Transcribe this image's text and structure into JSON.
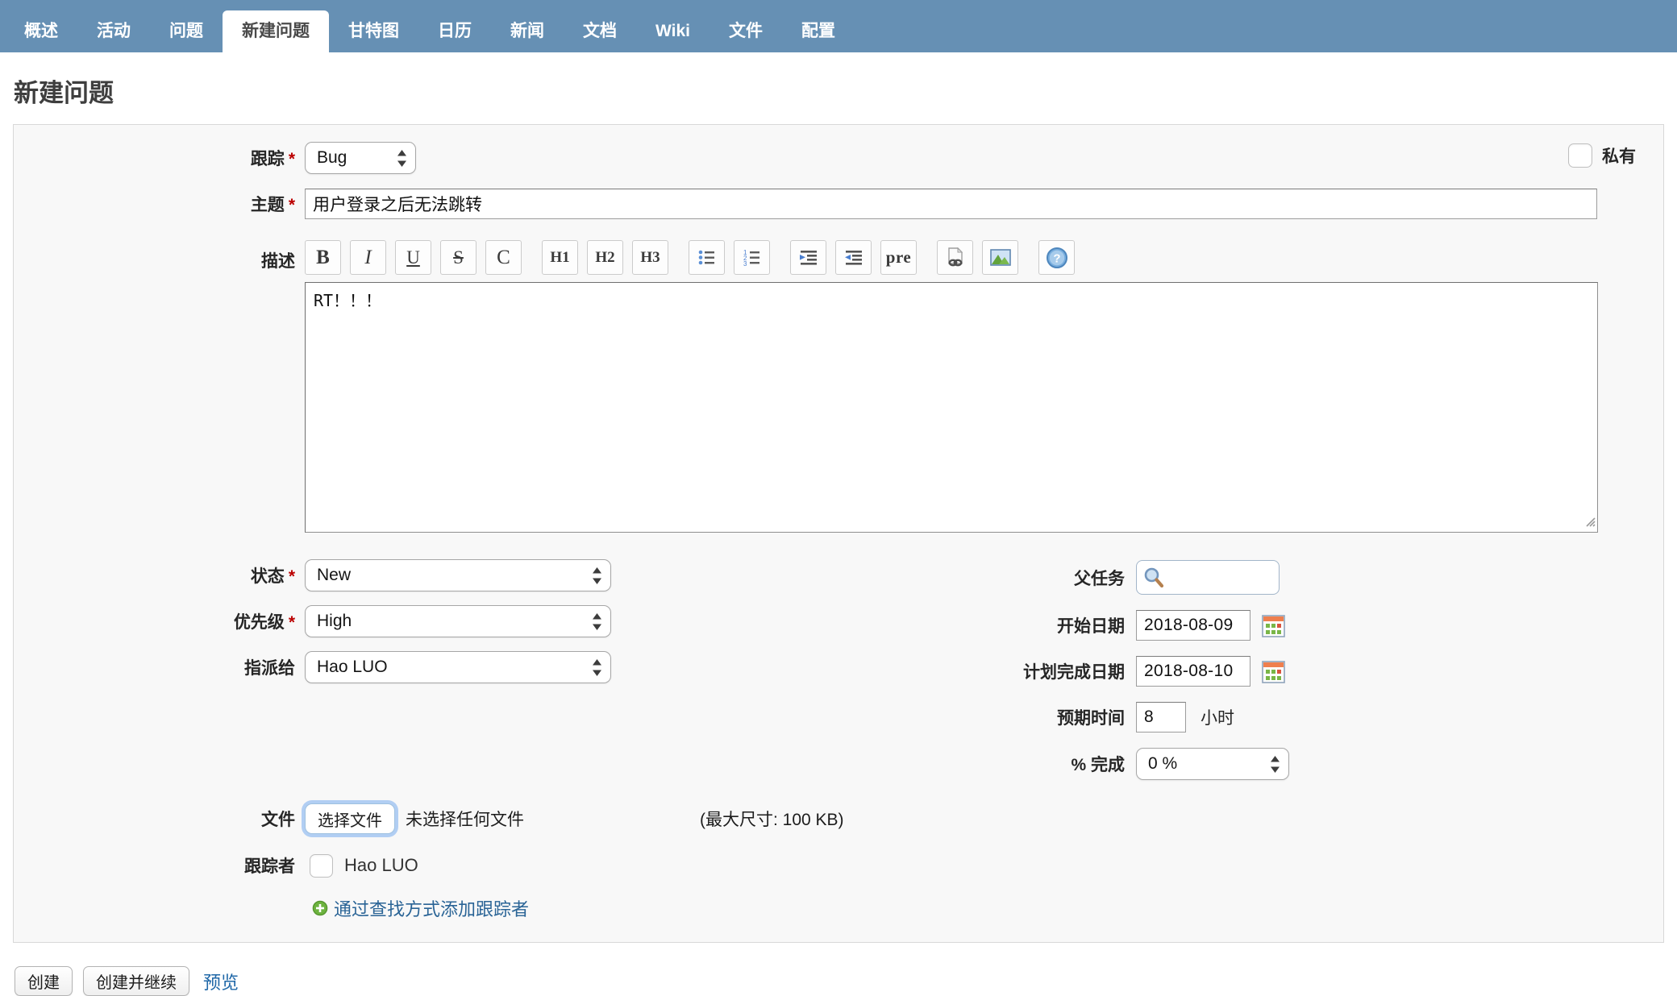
{
  "ui": {
    "required_marker": "*"
  },
  "nav": {
    "items": [
      {
        "label": "概述"
      },
      {
        "label": "活动"
      },
      {
        "label": "问题"
      },
      {
        "label": "新建问题",
        "active": true
      },
      {
        "label": "甘特图"
      },
      {
        "label": "日历"
      },
      {
        "label": "新闻"
      },
      {
        "label": "文档"
      },
      {
        "label": "Wiki"
      },
      {
        "label": "文件"
      },
      {
        "label": "配置"
      }
    ]
  },
  "page": {
    "title": "新建问题"
  },
  "form": {
    "tracker": {
      "label": "跟踪",
      "value": "Bug"
    },
    "is_private": {
      "label": "私有",
      "checked": false
    },
    "subject": {
      "label": "主题",
      "value": "用户登录之后无法跳转"
    },
    "description": {
      "label": "描述",
      "value": "RT！！！"
    },
    "toolbar": {
      "buttons": [
        {
          "name": "bold",
          "label": "B"
        },
        {
          "name": "italic",
          "label": "I"
        },
        {
          "name": "underline",
          "label": "U"
        },
        {
          "name": "strikethrough",
          "label": "S"
        },
        {
          "name": "code",
          "label": "C"
        },
        {
          "name": "heading1",
          "label": "H1"
        },
        {
          "name": "heading2",
          "label": "H2"
        },
        {
          "name": "heading3",
          "label": "H3"
        },
        {
          "name": "unordered-list"
        },
        {
          "name": "ordered-list"
        },
        {
          "name": "quote"
        },
        {
          "name": "unquote"
        },
        {
          "name": "preformatted",
          "label": "pre"
        },
        {
          "name": "wiki-link"
        },
        {
          "name": "image"
        },
        {
          "name": "help"
        }
      ]
    },
    "status": {
      "label": "状态",
      "value": "New"
    },
    "priority": {
      "label": "优先级",
      "value": "High"
    },
    "assignee": {
      "label": "指派给",
      "value": "Hao LUO"
    },
    "parent_task": {
      "label": "父任务",
      "value": ""
    },
    "start_date": {
      "label": "开始日期",
      "value": "2018-08-09"
    },
    "due_date": {
      "label": "计划完成日期",
      "value": "2018-08-10"
    },
    "estimated_hours": {
      "label": "预期时间",
      "value": "8",
      "unit": "小时"
    },
    "done_ratio": {
      "label": "% 完成",
      "value": "0 %"
    },
    "attachments": {
      "label": "文件",
      "choose_button": "选择文件",
      "no_file_text": "未选择任何文件",
      "max_size_text": "(最大尺寸: 100 KB)"
    },
    "watchers": {
      "label": "跟踪者",
      "candidates": [
        {
          "name": "Hao LUO",
          "checked": false
        }
      ],
      "add_link": "通过查找方式添加跟踪者"
    }
  },
  "actions": {
    "create": "创建",
    "create_and_continue": "创建并继续",
    "preview": "预览"
  },
  "colors": {
    "nav_bg": "#6690b4",
    "link": "#2068a8",
    "required": "#bb0000",
    "box_bg": "#f8f8f8"
  }
}
